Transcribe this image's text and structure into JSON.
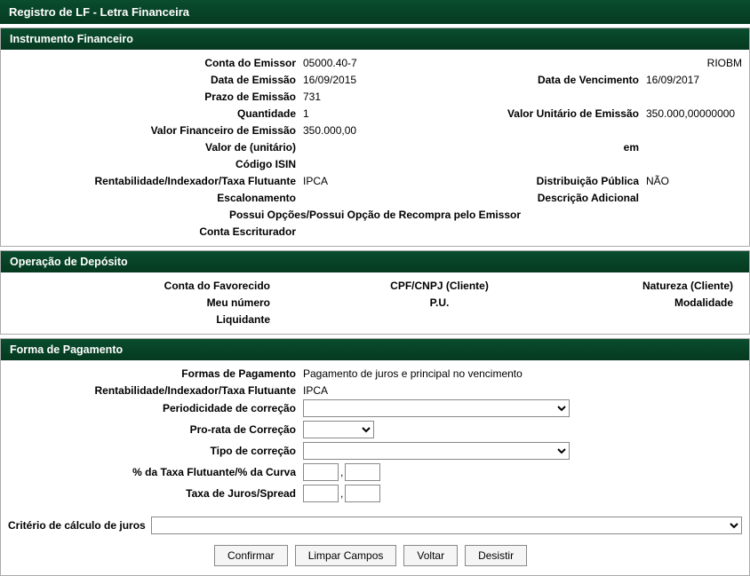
{
  "page_title": "Registro de LF - Letra Financeira",
  "instrumento": {
    "header": "Instrumento Financeiro",
    "conta_emissor_label": "Conta do Emissor",
    "conta_emissor_value": "05000.40-7",
    "riobm": "RIOBM",
    "data_emissao_label": "Data de Emissão",
    "data_emissao_value": "16/09/2015",
    "data_vencimento_label": "Data de Vencimento",
    "data_vencimento_value": "16/09/2017",
    "prazo_emissao_label": "Prazo de Emissão",
    "prazo_emissao_value": "731",
    "quantidade_label": "Quantidade",
    "quantidade_value": "1",
    "valor_unitario_emissao_label": "Valor Unitário de Emissão",
    "valor_unitario_emissao_value": "350.000,00000000",
    "valor_financeiro_emissao_label": "Valor Financeiro de Emissão",
    "valor_financeiro_emissao_value": "350.000,00",
    "valor_de_unitario_label": "Valor de (unitário)",
    "em_label": "em",
    "codigo_isin_label": "Código ISIN",
    "rentabilidade_label": "Rentabilidade/Indexador/Taxa Flutuante",
    "rentabilidade_value": "IPCA",
    "distribuicao_publica_label": "Distribuição Pública",
    "distribuicao_publica_value": "NÃO",
    "escalonamento_label": "Escalonamento",
    "descricao_adicional_label": "Descrição Adicional",
    "possui_opcoes_label": "Possui Opções/Possui Opção de Recompra pelo Emissor",
    "conta_escriturador_label": "Conta Escriturador"
  },
  "deposito": {
    "header": "Operação de Depósito",
    "conta_favorecido_label": "Conta do Favorecido",
    "cpf_cnpj_label": "CPF/CNPJ (Cliente)",
    "natureza_label": "Natureza (Cliente)",
    "meu_numero_label": "Meu número",
    "pu_label": "P.U.",
    "modalidade_label": "Modalidade",
    "liquidante_label": "Liquidante"
  },
  "pagamento": {
    "header": "Forma de Pagamento",
    "formas_pagamento_label": "Formas de Pagamento",
    "formas_pagamento_value": "Pagamento de juros e principal no vencimento",
    "rentabilidade_label": "Rentabilidade/Indexador/Taxa Flutuante",
    "rentabilidade_value": "IPCA",
    "periodicidade_label": "Periodicidade de correção",
    "prorata_label": "Pro-rata de Correção",
    "tipo_correcao_label": "Tipo de correção",
    "pct_taxa_label": "% da Taxa Flutuante/% da Curva",
    "taxa_juros_label": "Taxa de Juros/Spread",
    "criterio_calculo_label": "Critério de cálculo de juros",
    "comma": ","
  },
  "buttons": {
    "confirmar": "Confirmar",
    "limpar": "Limpar Campos",
    "voltar": "Voltar",
    "desistir": "Desistir"
  }
}
